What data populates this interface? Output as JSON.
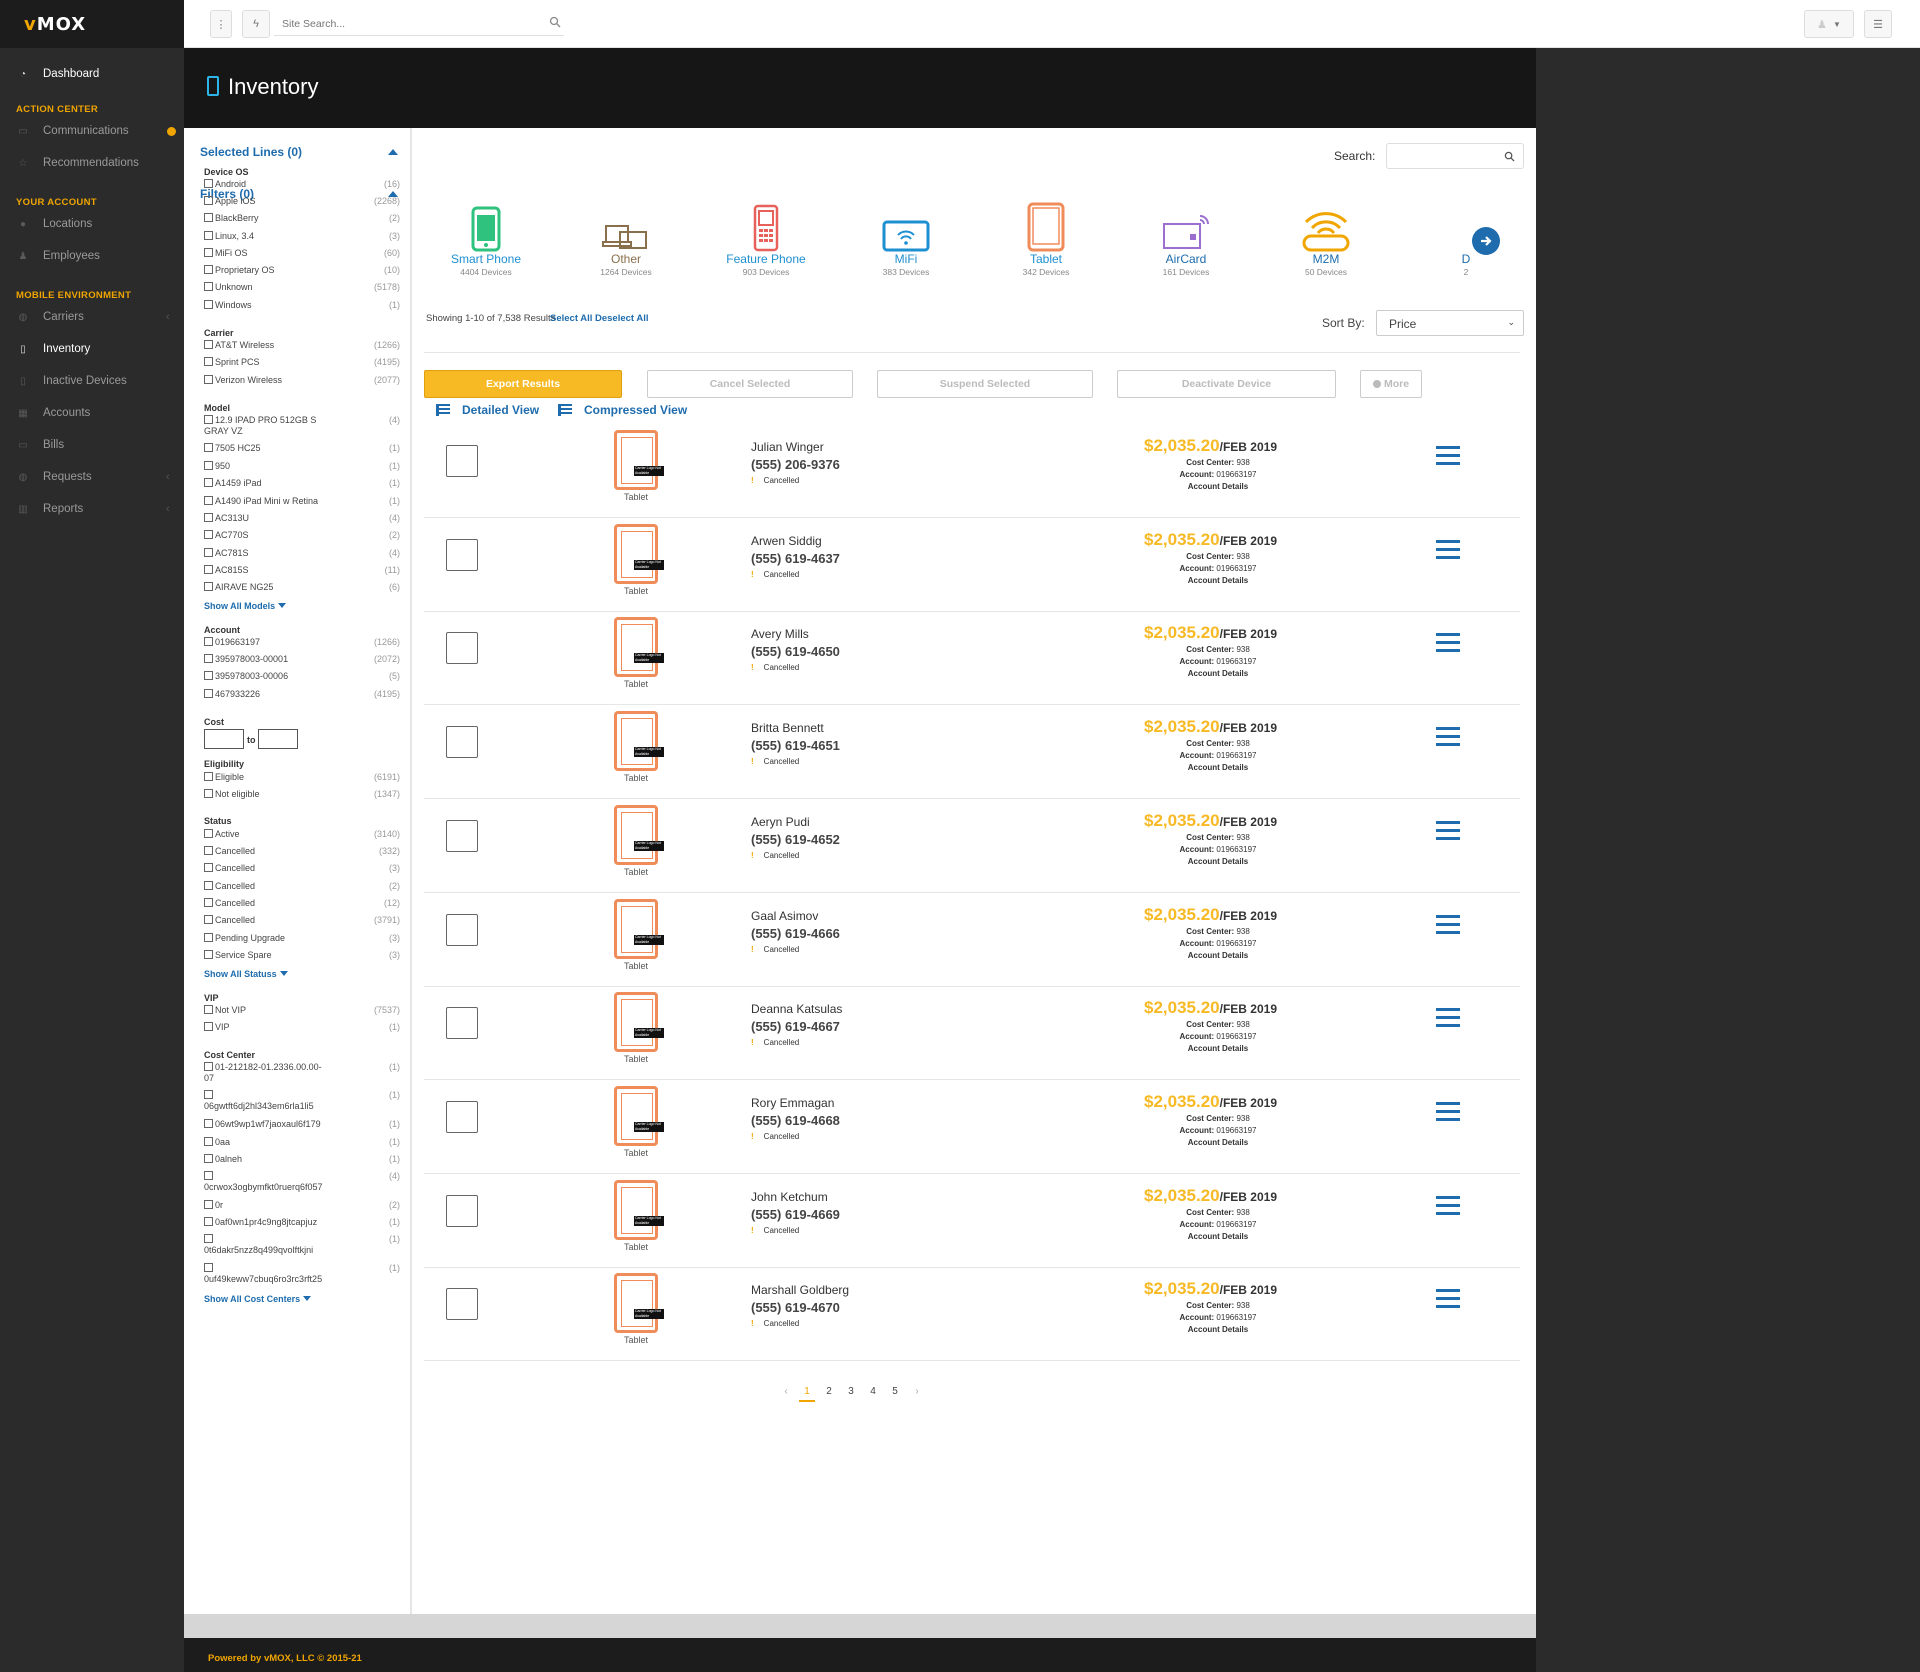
{
  "sidebar": {
    "logo": "MOX",
    "logo_v": "v",
    "dashboard": "Dashboard",
    "sections": {
      "action_center": "ACTION CENTER",
      "your_account": "YOUR ACCOUNT",
      "mobile_env": "MOBILE ENVIRONMENT"
    },
    "items": {
      "communications": "Communications",
      "recommendations": "Recommendations",
      "locations": "Locations",
      "employees": "Employees",
      "carriers": "Carriers",
      "inventory": "Inventory",
      "inactive": "Inactive Devices",
      "accounts": "Accounts",
      "bills": "Bills",
      "requests": "Requests",
      "reports": "Reports"
    }
  },
  "topbar": {
    "search_placeholder": "Site Search..."
  },
  "page": {
    "title": "Inventory"
  },
  "filters": {
    "selected_lines": "Selected Lines (0)",
    "filters_title": "Filters (0)",
    "device_os": {
      "title": "Device OS",
      "items": [
        {
          "label": "Android",
          "count": "(16)"
        },
        {
          "label": "Apple iOS",
          "count": "(2268)"
        },
        {
          "label": "BlackBerry",
          "count": "(2)"
        },
        {
          "label": "Linux, 3.4",
          "count": "(3)"
        },
        {
          "label": "MiFi OS",
          "count": "(60)"
        },
        {
          "label": "Proprietary OS",
          "count": "(10)"
        },
        {
          "label": "Unknown",
          "count": "(5178)"
        },
        {
          "label": "Windows",
          "count": "(1)"
        }
      ]
    },
    "carrier": {
      "title": "Carrier",
      "items": [
        {
          "label": "AT&T Wireless",
          "count": "(1266)"
        },
        {
          "label": "Sprint PCS",
          "count": "(4195)"
        },
        {
          "label": "Verizon Wireless",
          "count": "(2077)"
        }
      ]
    },
    "model": {
      "title": "Model",
      "items": [
        {
          "label": "12.9 IPAD PRO 512GB S",
          "label2": "GRAY VZ",
          "count": "(4)"
        },
        {
          "label": "7505 HC25",
          "count": "(1)"
        },
        {
          "label": "950",
          "count": "(1)"
        },
        {
          "label": "A1459 iPad",
          "count": "(1)"
        },
        {
          "label": "A1490 iPad Mini w Retina",
          "count": "(1)"
        },
        {
          "label": "AC313U",
          "count": "(4)"
        },
        {
          "label": "AC770S",
          "count": "(2)"
        },
        {
          "label": "AC781S",
          "count": "(4)"
        },
        {
          "label": "AC815S",
          "count": "(11)"
        },
        {
          "label": "AIRAVE NG25",
          "count": "(6)"
        }
      ],
      "show_all": "Show All Models"
    },
    "account": {
      "title": "Account",
      "items": [
        {
          "label": "019663197",
          "count": "(1266)"
        },
        {
          "label": "395978003-00001",
          "count": "(2072)"
        },
        {
          "label": "395978003-00006",
          "count": "(5)"
        },
        {
          "label": "467933226",
          "count": "(4195)"
        }
      ]
    },
    "cost": {
      "title": "Cost",
      "to": "to"
    },
    "eligibility": {
      "title": "Eligibility",
      "items": [
        {
          "label": "Eligible",
          "count": "(6191)"
        },
        {
          "label": "Not eligible",
          "count": "(1347)"
        }
      ]
    },
    "status": {
      "title": "Status",
      "items": [
        {
          "label": "Active",
          "count": "(3140)"
        },
        {
          "label": "Cancelled",
          "count": "(332)"
        },
        {
          "label": "Cancelled",
          "count": "(3)"
        },
        {
          "label": "Cancelled",
          "count": "(2)"
        },
        {
          "label": "Cancelled",
          "count": "(12)"
        },
        {
          "label": "Cancelled",
          "count": "(3791)"
        },
        {
          "label": "Pending Upgrade",
          "count": "(3)"
        },
        {
          "label": "Service Spare",
          "count": "(3)"
        }
      ],
      "show_all": "Show All Statuss"
    },
    "vip": {
      "title": "VIP",
      "items": [
        {
          "label": "Not VIP",
          "count": "(7537)"
        },
        {
          "label": "VIP",
          "count": "(1)"
        }
      ]
    },
    "cost_center": {
      "title": "Cost Center",
      "items": [
        {
          "label": "01-212182-01.2336.00.00-",
          "label2": "07",
          "count": "(1)"
        },
        {
          "label": "",
          "label2": "06gwtft6dj2hl343em6rla1li5",
          "count": "(1)"
        },
        {
          "label": "06wt9wp1wf7jaoxaul6f179",
          "count": "(1)"
        },
        {
          "label": "0aa",
          "count": "(1)"
        },
        {
          "label": "0alneh",
          "count": "(1)"
        },
        {
          "label": "",
          "label2": "0crwox3ogbymfkt0ruerq6f057",
          "count": "(4)"
        },
        {
          "label": "0r",
          "count": "(2)"
        },
        {
          "label": "0af0wn1pr4c9ng8jtcapjuz",
          "count": "(1)"
        },
        {
          "label": "",
          "label2": "0t6dakr5nzz8q499qvolftkjni",
          "count": "(1)"
        },
        {
          "label": "",
          "label2": "0uf49keww7cbuq6ro3rc3rft25",
          "count": "(1)"
        }
      ],
      "show_all": "Show All Cost Centers"
    }
  },
  "results": {
    "search_label": "Search:",
    "categories": [
      {
        "name": "Smart Phone",
        "count": "4404 Devices",
        "color": "#2ec27e"
      },
      {
        "name": "Other",
        "count": "1264 Devices",
        "color": "#8a6f4d"
      },
      {
        "name": "Feature Phone",
        "count": "903 Devices",
        "color": "#e8605a"
      },
      {
        "name": "MiFi",
        "count": "383 Devices",
        "color": "#1e8fd0"
      },
      {
        "name": "Tablet",
        "count": "342 Devices",
        "color": "#f08c5a"
      },
      {
        "name": "AirCard",
        "count": "161 Devices",
        "color": "#9a6fd0"
      },
      {
        "name": "M2M",
        "count": "50 Devices",
        "color": "#f0a500"
      },
      {
        "name": "D",
        "count": "2",
        "color": "#1e6cad"
      }
    ],
    "showing": "Showing 1-10 of 7,538 Results",
    "select_all": "Select All",
    "deselect_all": "Deselect All",
    "sort_label": "Sort By:",
    "sort_value": "Price",
    "actions": {
      "export": "Export Results",
      "cancel": "Cancel Selected",
      "suspend": "Suspend Selected",
      "deactivate": "Deactivate Device",
      "more": "More"
    },
    "views": {
      "detailed": "Detailed View",
      "compressed": "Compressed View"
    },
    "rows": [
      {
        "name": "Julian Winger",
        "phone": "(555) 206-9376"
      },
      {
        "name": "Arwen Siddig",
        "phone": "(555) 619-4637"
      },
      {
        "name": "Avery Mills",
        "phone": "(555) 619-4650"
      },
      {
        "name": "Britta Bennett",
        "phone": "(555) 619-4651"
      },
      {
        "name": "Aeryn Pudi",
        "phone": "(555) 619-4652"
      },
      {
        "name": "Gaal Asimov",
        "phone": "(555) 619-4666"
      },
      {
        "name": "Deanna Katsulas",
        "phone": "(555) 619-4667"
      },
      {
        "name": "Rory Emmagan",
        "phone": "(555) 619-4668"
      },
      {
        "name": "John Ketchum",
        "phone": "(555) 619-4669"
      },
      {
        "name": "Marshall Goldberg",
        "phone": "(555) 619-4670"
      }
    ],
    "row_common": {
      "type": "Tablet",
      "badge": "Carrier Logo Not Available",
      "status": "Cancelled",
      "price": "$2,035.20",
      "period": "/FEB 2019",
      "cost_center_label": "Cost Center:",
      "cost_center": "938",
      "account_label": "Account:",
      "account": "019663197",
      "details": "Account Details"
    },
    "pagination": {
      "prev": "‹",
      "pages": [
        "1",
        "2",
        "3",
        "4",
        "5"
      ],
      "next": "›",
      "current": "1"
    }
  },
  "footer": {
    "text": "Powered by vMOX, LLC © 2015-21"
  }
}
